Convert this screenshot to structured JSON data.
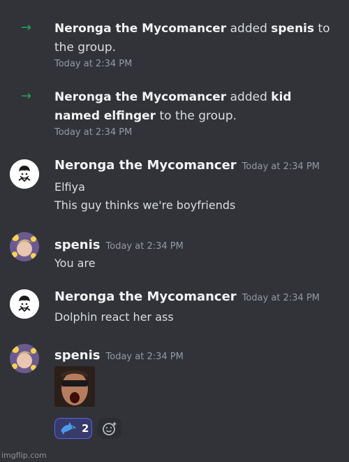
{
  "system_messages": [
    {
      "actor": "Neronga the Mycomancer",
      "verb": "added",
      "target": "spenis",
      "suffix": "to the group.",
      "time": "Today at 2:34 PM"
    },
    {
      "actor": "Neronga the Mycomancer",
      "verb": "added",
      "target": "kid named elfinger",
      "suffix": "to the group.",
      "time": "Today at 2:34 PM"
    }
  ],
  "messages": [
    {
      "author": "Neronga the Mycomancer",
      "time": "Today at 2:34 PM",
      "lines": [
        "Elfiya",
        "This guy thinks we're boyfriends"
      ]
    },
    {
      "author": "spenis",
      "time": "Today at 2:34 PM",
      "lines": [
        "You are"
      ]
    },
    {
      "author": "Neronga the Mycomancer",
      "time": "Today at 2:34 PM",
      "lines": [
        "Dolphin react her ass"
      ]
    },
    {
      "author": "spenis",
      "time": "Today at 2:34 PM",
      "lines": []
    }
  ],
  "reaction": {
    "emoji": "dolphin-icon",
    "count": "2"
  },
  "icons": {
    "system": "arrow-right-icon",
    "add_reaction": "add-reaction-icon"
  },
  "colors": {
    "background": "#313338",
    "accent": "#5865f2",
    "join_green": "#23a55a"
  },
  "watermark": "imgflip.com"
}
